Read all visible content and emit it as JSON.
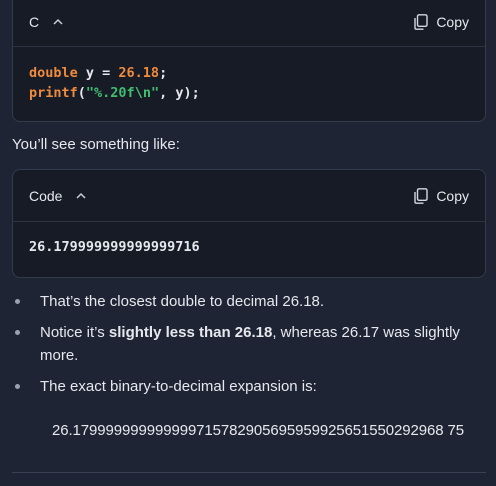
{
  "block1": {
    "language": "C",
    "copy_label": "Copy",
    "line1": {
      "kw": "double",
      "mid": " y = ",
      "num": "26.18",
      "end": ";"
    },
    "line2": {
      "fn": "printf",
      "open": "(",
      "str": "\"%.20f\\n\"",
      "end": ", y);"
    }
  },
  "intro_text": "You’ll see something like:",
  "block2": {
    "language": "Code",
    "copy_label": "Copy",
    "output": "26.179999999999999716"
  },
  "bullets": {
    "b1": "That’s the closest double to decimal 26.18.",
    "b2_pre": "Notice it’s ",
    "b2_bold": "slightly less than 26.18",
    "b2_post": ", whereas 26.17 was slightly more.",
    "b3": "The exact binary-to-decimal expansion is:"
  },
  "expansion": "26.179999999999999715782905695959925651550292968 75"
}
